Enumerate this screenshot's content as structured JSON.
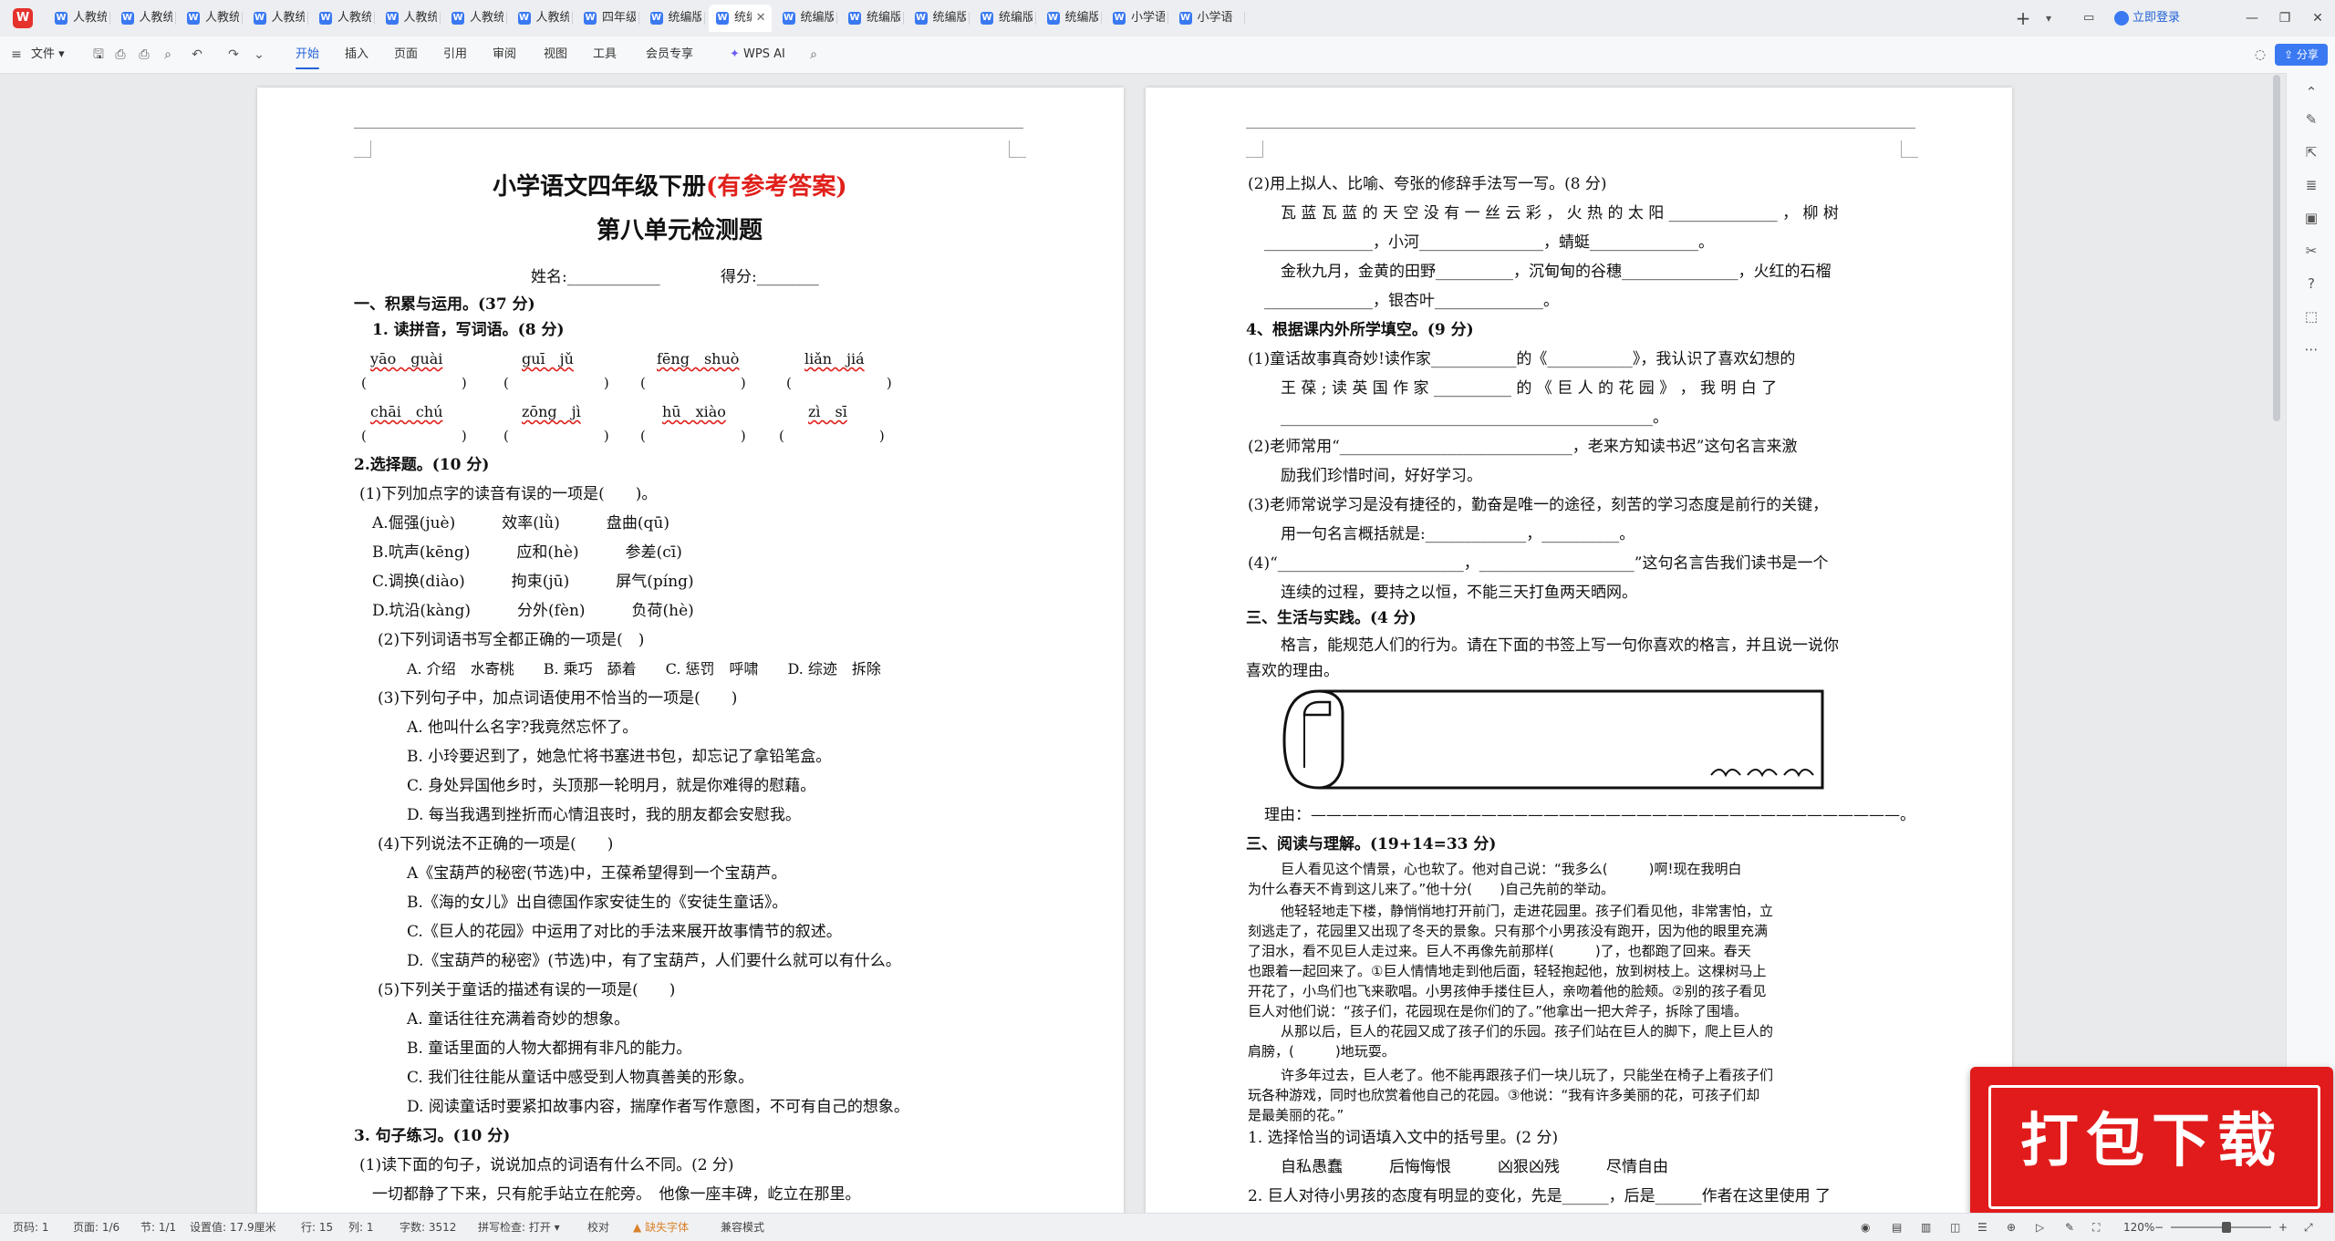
{
  "app": {
    "logo": "W"
  },
  "tabs": [
    {
      "label": "人教统编版四"
    },
    {
      "label": "人教统编版四"
    },
    {
      "label": "人教统编版四"
    },
    {
      "label": "人教统编版四"
    },
    {
      "label": "人教统编版四"
    },
    {
      "label": "人教统编版四"
    },
    {
      "label": "人教统编版四"
    },
    {
      "label": "人教统编版四"
    },
    {
      "label": "四年级语文下"
    },
    {
      "label": "统编版四年级"
    },
    {
      "label": "统编版四年"
    },
    {
      "label": "统编版四年级"
    },
    {
      "label": "统编版小学语"
    },
    {
      "label": "统编版小学语"
    },
    {
      "label": "统编版语文四"
    },
    {
      "label": "统编版语文四"
    },
    {
      "label": "小学语文四年"
    },
    {
      "label": "小学语"
    }
  ],
  "titlebar": {
    "login": "立即登录"
  },
  "toolbar": {
    "file": "文件",
    "menus": [
      "开始",
      "插入",
      "页面",
      "引用",
      "审阅",
      "视图",
      "工具",
      "会员专享"
    ],
    "ai": "WPS AI"
  },
  "doc": {
    "title_main": "小学语文四年级下册",
    "title_red": "(有参考答案)",
    "subtitle": "第八单元检测题",
    "name_line": "姓名:____________",
    "score_line": "得分:________",
    "p1": [
      "一、积累与运用。(37 分)",
      "1. 读拼音，写词语。(8 分)",
      "2.选择题。(10 分)",
      "(1)下列加点字的读音有误的一项是(　　)。",
      "(2)下列词语书写全都正确的一项是(　)",
      "A. 介绍　水寄桃　　B. 乘巧　舔着　　C. 惩罚　呼啸　　D. 综迹　拆除",
      "(3)下列句子中，加点词语使用不恰当的一项是(　　)",
      "A. 他叫什么名字?我竟然忘怀了。",
      "B. 小玲要迟到了，她急忙将书塞进书包，却忘记了拿铅笔盒。",
      "C. 身处异国他乡时，头顶那一轮明月，就是你难得的慰藉。",
      "D. 每当我遇到挫折而心情沮丧时，我的朋友都会安慰我。",
      "(4)下列说法不正确的一项是(　　)",
      "A《宝葫芦的秘密(节选)中，王葆希望得到一个宝葫芦。",
      "B.《海的女儿》出自德国作家安徒生的《安徒生童话》。",
      "C.《巨人的花园》中运用了对比的手法来展开故事情节的叙述。",
      "D.《宝葫芦的秘密》(节选)中，有了宝葫芦，人们要什么就可以有什么。",
      "(5)下列关于童话的描述有误的一项是(　　)",
      "A. 童话往往充满着奇妙的想象。",
      "B. 童话里面的人物大都拥有非凡的能力。",
      "C. 我们往往能从童话中感受到人物真善美的形象。",
      "D. 阅读童话时要紧扣故事内容，揣摩作者写作意图，不可有自己的想象。",
      "3. 句子练习。(10 分)",
      "(1)读下面的句子，说说加点的词语有什么不同。(2 分)",
      "一切都静了下来，只有舵手站立在舵旁。　他像一座丰碑，屹立在那里。"
    ],
    "pinyin1": [
      "yāo　guài",
      "guī　jǔ",
      "fēng　shuò",
      "liǎn　jiá"
    ],
    "pinyin2": [
      "chāi　chú",
      "zōng　jì",
      "hū　xiào",
      "zì　sī"
    ],
    "paren": "(　　　　　　)",
    "choices": [
      "A.倔强(juè)　　　效率(lǜ)　　　盘曲(qū)",
      "B.吭声(kēng)　　　应和(hè)　　　参差(cī)",
      "C.调换(diào)　　　拘束(jū)　　　屏气(píng)",
      "D.坑沿(kàng)　　　分外(fèn)　　　负荷(hè)"
    ],
    "p2": [
      "(2)用上拟人、比喻、夸张的修辞手法写一写。(8 分)",
      "瓦 蓝 瓦 蓝 的 天 空 没 有 一 丝 云 彩 ， 火 热 的 太 阳 ______________ ， 柳 树",
      "______________，小河________________，蜻蜓______________。",
      "金秋九月，金黄的田野__________，沉甸甸的谷穗_______________，火红的石榴",
      "______________，银杏叶______________。",
      "4、根据课内外所学填空。(9 分)",
      "(1)童话故事真奇妙!读作家___________的《___________》，我认识了喜欢幻想的",
      "王 葆 ; 读 英 国 作 家 __________ 的 《 巨 人 的 花 园 》 ， 我 明 白 了",
      "________________________________________________。",
      "(2)老师常用“______________________________，老来方知读书迟”这句名言来激",
      "励我们珍惜时间，好好学习。",
      "(3)老师常说学习是没有捷径的，勤奋是唯一的途径，刻苦的学习态度是前行的关键，",
      "用一句名言概括就是:_____________，__________。",
      "(4)“________________________，____________________”这句名言告我们读书是一个",
      "连续的过程，要持之以恒，不能三天打鱼两天晒网。",
      "三、生活与实践。(4 分)",
      "格言，能规范人们的行为。请在下面的书签上写一句你喜欢的格言，并且说一说你",
      "喜欢的理由。",
      "理由：——————————————————————————————————————。",
      "三、阅读与理解。(19+14=33 分)",
      "巨人看见这个情景，心也软了。他对自己说：“我多么(　　　)啊!现在我明白",
      "为什么春天不肯到这儿来了。”他十分(　　)自己先前的举动。",
      "他轻轻地走下楼，静悄悄地打开前门，走进花园里。孩子们看见他，非常害怕，立",
      "刻逃走了，花园里又出现了冬天的景象。只有那个小男孩没有跑开，因为他的眼里充满",
      "了泪水，看不见巨人走过来。巨人不再像先前那样(　　　)了，也都跑了回来。春天",
      "也跟着一起回来了。①巨人情情地走到他后面，轻轻抱起他，放到树枝上。这棵树马上",
      "开花了，小鸟们也飞来歌唱。小男孩伸手搂住巨人，亲吻着他的脸颊。②别的孩子看见",
      "巨人对他们说：“孩子们，花园现在是你们的了。”他拿出一把大斧子，拆除了围墙。",
      "从那以后，巨人的花园又成了孩子们的乐园。孩子们站在巨人的脚下，爬上巨人的",
      "肩膀，(　　　)地玩耍。",
      "许多年过去，巨人老了。他不能再跟孩子们一块儿玩了，只能坐在椅子上看孩子们",
      "玩各种游戏，同时也欣赏着他自己的花园。③他说：“我有许多美丽的花，可孩子们却",
      "是最美丽的花。”",
      "1. 选择恰当的词语填入文中的括号里。(2 分)",
      "自私愚蠢　　　后悔悔恨　　　凶狠凶残　　　尽情自由",
      "2. 巨人对待小男孩的态度有明显的变化，先是______，后是______作者在这里使用 了"
    ]
  },
  "statusbar": {
    "page": "页码: 1",
    "pages": "页面: 1/6",
    "section": "节: 1/1",
    "setting": "设置值: 17.9厘米",
    "row": "行: 15",
    "col": "列: 1",
    "words": "字数: 3512",
    "spell": "拼写检查: 打开",
    "proof": "校对",
    "font_missing": "缺失字体",
    "compat": "兼容模式",
    "zoom": "120%"
  },
  "badge": {
    "text": "打包下载"
  },
  "colors": {
    "accent": "#2463d8",
    "title_red": "#e0201b",
    "badge": "#e11b1b"
  }
}
